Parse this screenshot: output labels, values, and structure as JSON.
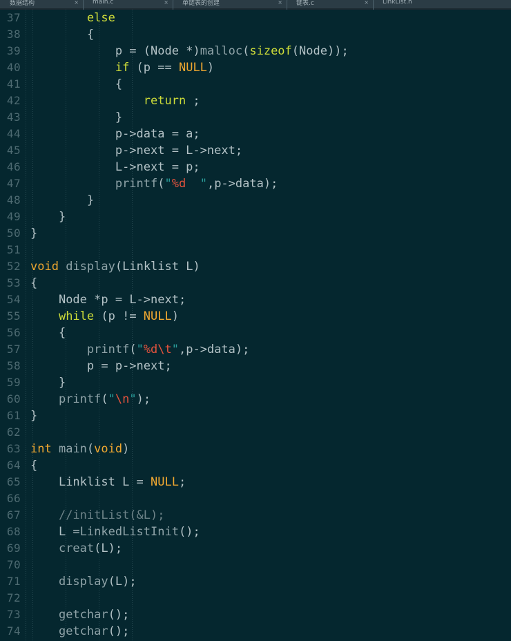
{
  "window": {
    "app": "code-editor",
    "theme_background": "#05272f",
    "tabstrip_background": "#2b3c45"
  },
  "tabs": [
    {
      "label": "数据结构",
      "close_glyph": "×",
      "active": false
    },
    {
      "label": "main.c",
      "close_glyph": "×",
      "active": false
    },
    {
      "label": "单链表的创建",
      "close_glyph": "×",
      "active": false
    },
    {
      "label": "链表.c",
      "close_glyph": "×",
      "active": false
    },
    {
      "label": "LinkList.h",
      "close_glyph": "×",
      "active": true
    }
  ],
  "editor": {
    "first_line_number": 37,
    "last_line_number": 74,
    "language": "c",
    "colors": {
      "background": "#05272f",
      "gutter_text": "#4e6b72",
      "default_text": "#b3c2c6",
      "keyword": "#cddc39",
      "type": "#f0a830",
      "function": "#8fa3a8",
      "string": "#2a9d9a",
      "escape": "#e5533d",
      "comment": "#6d8388"
    },
    "lines": [
      {
        "n": 37,
        "tokens": [
          {
            "t": "        ",
            "c": "id"
          },
          {
            "t": "else",
            "c": "kw"
          }
        ]
      },
      {
        "n": 38,
        "tokens": [
          {
            "t": "        ",
            "c": "id"
          },
          {
            "t": "{",
            "c": "brc"
          }
        ]
      },
      {
        "n": 39,
        "tokens": [
          {
            "t": "            ",
            "c": "id"
          },
          {
            "t": "p = (",
            "c": "id"
          },
          {
            "t": "Node",
            "c": "id"
          },
          {
            "t": " *)",
            "c": "id"
          },
          {
            "t": "malloc",
            "c": "fn"
          },
          {
            "t": "(",
            "c": "id"
          },
          {
            "t": "sizeof",
            "c": "kw"
          },
          {
            "t": "(",
            "c": "id"
          },
          {
            "t": "Node",
            "c": "id"
          },
          {
            "t": "));",
            "c": "id"
          }
        ]
      },
      {
        "n": 40,
        "tokens": [
          {
            "t": "            ",
            "c": "id"
          },
          {
            "t": "if",
            "c": "kw"
          },
          {
            "t": " (p == ",
            "c": "id"
          },
          {
            "t": "NULL",
            "c": "ty"
          },
          {
            "t": ")",
            "c": "id"
          }
        ]
      },
      {
        "n": 41,
        "tokens": [
          {
            "t": "            ",
            "c": "id"
          },
          {
            "t": "{",
            "c": "brc"
          }
        ]
      },
      {
        "n": 42,
        "tokens": [
          {
            "t": "                ",
            "c": "id"
          },
          {
            "t": "return",
            "c": "kw"
          },
          {
            "t": " ;",
            "c": "id"
          }
        ]
      },
      {
        "n": 43,
        "tokens": [
          {
            "t": "            ",
            "c": "id"
          },
          {
            "t": "}",
            "c": "brc"
          }
        ]
      },
      {
        "n": 44,
        "tokens": [
          {
            "t": "            ",
            "c": "id"
          },
          {
            "t": "p->data = a;",
            "c": "id"
          }
        ]
      },
      {
        "n": 45,
        "tokens": [
          {
            "t": "            ",
            "c": "id"
          },
          {
            "t": "p->next = L->next;",
            "c": "id"
          }
        ]
      },
      {
        "n": 46,
        "tokens": [
          {
            "t": "            ",
            "c": "id"
          },
          {
            "t": "L->next = p;",
            "c": "id"
          }
        ]
      },
      {
        "n": 47,
        "tokens": [
          {
            "t": "            ",
            "c": "id"
          },
          {
            "t": "printf",
            "c": "fn"
          },
          {
            "t": "(",
            "c": "id"
          },
          {
            "t": "\"",
            "c": "str"
          },
          {
            "t": "%d",
            "c": "esc"
          },
          {
            "t": "  \"",
            "c": "str"
          },
          {
            "t": ",p->data);",
            "c": "id"
          }
        ]
      },
      {
        "n": 48,
        "tokens": [
          {
            "t": "        ",
            "c": "id"
          },
          {
            "t": "}",
            "c": "brc"
          }
        ]
      },
      {
        "n": 49,
        "tokens": [
          {
            "t": "    ",
            "c": "id"
          },
          {
            "t": "}",
            "c": "brc"
          }
        ]
      },
      {
        "n": 50,
        "tokens": [
          {
            "t": "}",
            "c": "brc"
          }
        ]
      },
      {
        "n": 51,
        "tokens": []
      },
      {
        "n": 52,
        "tokens": [
          {
            "t": "void",
            "c": "ty"
          },
          {
            "t": " ",
            "c": "id"
          },
          {
            "t": "display",
            "c": "fn"
          },
          {
            "t": "(",
            "c": "id"
          },
          {
            "t": "Linklist",
            "c": "id"
          },
          {
            "t": " L)",
            "c": "id"
          }
        ]
      },
      {
        "n": 53,
        "tokens": [
          {
            "t": "{",
            "c": "brc"
          }
        ]
      },
      {
        "n": 54,
        "tokens": [
          {
            "t": "    ",
            "c": "id"
          },
          {
            "t": "Node",
            "c": "id"
          },
          {
            "t": " *p = L->next;",
            "c": "id"
          }
        ]
      },
      {
        "n": 55,
        "tokens": [
          {
            "t": "    ",
            "c": "id"
          },
          {
            "t": "while",
            "c": "kw"
          },
          {
            "t": " (p != ",
            "c": "id"
          },
          {
            "t": "NULL",
            "c": "ty"
          },
          {
            "t": ")",
            "c": "id"
          }
        ]
      },
      {
        "n": 56,
        "tokens": [
          {
            "t": "    ",
            "c": "id"
          },
          {
            "t": "{",
            "c": "brc"
          }
        ]
      },
      {
        "n": 57,
        "tokens": [
          {
            "t": "        ",
            "c": "id"
          },
          {
            "t": "printf",
            "c": "fn"
          },
          {
            "t": "(",
            "c": "id"
          },
          {
            "t": "\"",
            "c": "str"
          },
          {
            "t": "%d\\t",
            "c": "esc"
          },
          {
            "t": "\"",
            "c": "str"
          },
          {
            "t": ",p->data);",
            "c": "id"
          }
        ]
      },
      {
        "n": 58,
        "tokens": [
          {
            "t": "        ",
            "c": "id"
          },
          {
            "t": "p = p->next;",
            "c": "id"
          }
        ]
      },
      {
        "n": 59,
        "tokens": [
          {
            "t": "    ",
            "c": "id"
          },
          {
            "t": "}",
            "c": "brc"
          }
        ]
      },
      {
        "n": 60,
        "tokens": [
          {
            "t": "    ",
            "c": "id"
          },
          {
            "t": "printf",
            "c": "fn"
          },
          {
            "t": "(",
            "c": "id"
          },
          {
            "t": "\"",
            "c": "str"
          },
          {
            "t": "\\n",
            "c": "esc"
          },
          {
            "t": "\"",
            "c": "str"
          },
          {
            "t": ");",
            "c": "id"
          }
        ]
      },
      {
        "n": 61,
        "tokens": [
          {
            "t": "}",
            "c": "brc"
          }
        ]
      },
      {
        "n": 62,
        "tokens": []
      },
      {
        "n": 63,
        "tokens": [
          {
            "t": "int",
            "c": "ty"
          },
          {
            "t": " ",
            "c": "id"
          },
          {
            "t": "main",
            "c": "fn"
          },
          {
            "t": "(",
            "c": "id"
          },
          {
            "t": "void",
            "c": "ty"
          },
          {
            "t": ")",
            "c": "id"
          }
        ]
      },
      {
        "n": 64,
        "tokens": [
          {
            "t": "{",
            "c": "brc"
          }
        ]
      },
      {
        "n": 65,
        "tokens": [
          {
            "t": "    ",
            "c": "id"
          },
          {
            "t": "Linklist",
            "c": "id"
          },
          {
            "t": " L = ",
            "c": "id"
          },
          {
            "t": "NULL",
            "c": "ty"
          },
          {
            "t": ";",
            "c": "id"
          }
        ]
      },
      {
        "n": 66,
        "tokens": []
      },
      {
        "n": 67,
        "tokens": [
          {
            "t": "    ",
            "c": "id"
          },
          {
            "t": "//initList(&L);",
            "c": "cmt"
          }
        ]
      },
      {
        "n": 68,
        "tokens": [
          {
            "t": "    ",
            "c": "id"
          },
          {
            "t": "L =",
            "c": "id"
          },
          {
            "t": "LinkedListInit",
            "c": "fn"
          },
          {
            "t": "();",
            "c": "id"
          }
        ]
      },
      {
        "n": 69,
        "tokens": [
          {
            "t": "    ",
            "c": "id"
          },
          {
            "t": "creat",
            "c": "fn"
          },
          {
            "t": "(L);",
            "c": "id"
          }
        ]
      },
      {
        "n": 70,
        "tokens": []
      },
      {
        "n": 71,
        "tokens": [
          {
            "t": "    ",
            "c": "id"
          },
          {
            "t": "display",
            "c": "fn"
          },
          {
            "t": "(L);",
            "c": "id"
          }
        ]
      },
      {
        "n": 72,
        "tokens": []
      },
      {
        "n": 73,
        "tokens": [
          {
            "t": "    ",
            "c": "id"
          },
          {
            "t": "getchar",
            "c": "fn"
          },
          {
            "t": "();",
            "c": "id"
          }
        ]
      },
      {
        "n": 74,
        "tokens": [
          {
            "t": "    ",
            "c": "id"
          },
          {
            "t": "getchar",
            "c": "fn"
          },
          {
            "t": "();",
            "c": "id"
          }
        ]
      }
    ],
    "indent_guide_x": [
      47,
      95,
      143,
      191
    ]
  }
}
